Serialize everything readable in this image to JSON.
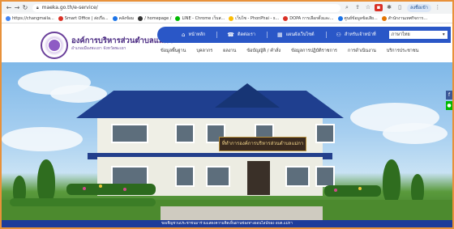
{
  "browser": {
    "url": "maeka.go.th/e-service/",
    "profile_label": "ลงชื่อเข้า",
    "bookmarks": [
      {
        "label": "https://changmaila...",
        "color": "#4285f4"
      },
      {
        "label": "Smart Office | ส่งเรื่อ...",
        "color": "#d93025"
      },
      {
        "label": "คลังข้อม",
        "color": "#1a73e8"
      },
      {
        "label": "/ homepage /",
        "color": "#333333"
      },
      {
        "label": "LINE - Chrome เว็บส...",
        "color": "#00b900"
      },
      {
        "label": "เว็บไซ - PhonPhai - s...",
        "color": "#fbbc04"
      },
      {
        "label": "DOPA การเลือกตั้งและ...",
        "color": "#d93025"
      },
      {
        "label": "ศูนย์ข้อมูลข้อเสีย...",
        "color": "#1a73e8"
      },
      {
        "label": "สำนักงานเทศกิจการ...",
        "color": "#e37400"
      }
    ]
  },
  "site": {
    "org_name": "องค์การบริหารส่วนตำบลแม่กา",
    "org_sub": "อำเภอเมืองพะเยา จังหวัดพะเยา",
    "top_menu": [
      {
        "icon": "home-icon",
        "glyph": "⌂",
        "label": "หน้าหลัก"
      },
      {
        "icon": "phone-icon",
        "glyph": "☎",
        "label": "ติดต่อเรา"
      },
      {
        "icon": "grid-icon",
        "glyph": "▦",
        "label": "แผนผังเว็บไซต์"
      },
      {
        "icon": "users-icon",
        "glyph": "⚇",
        "label": "สำหรับเจ้าหน้าที่"
      }
    ],
    "lang_value": "ภาษาไทย",
    "main_nav": [
      "ข้อมูลพื้นฐาน",
      "บุคลากร",
      "ผลงาน",
      "ข้อบัญญัติ / คำสั่ง",
      "ข้อมูลการปฏิบัติราชการ",
      "การดำเนินงาน",
      "บริการประชาชน"
    ],
    "building_sign": "ที่ทำการองค์การบริหารส่วนตำบลแม่กา",
    "footer_text": "ขอเชิญชวนประชาชนมาร่วมแสดงความคิดเห็นผ่านช่องทางออนไลน์ของ อบต.แม่กา"
  }
}
